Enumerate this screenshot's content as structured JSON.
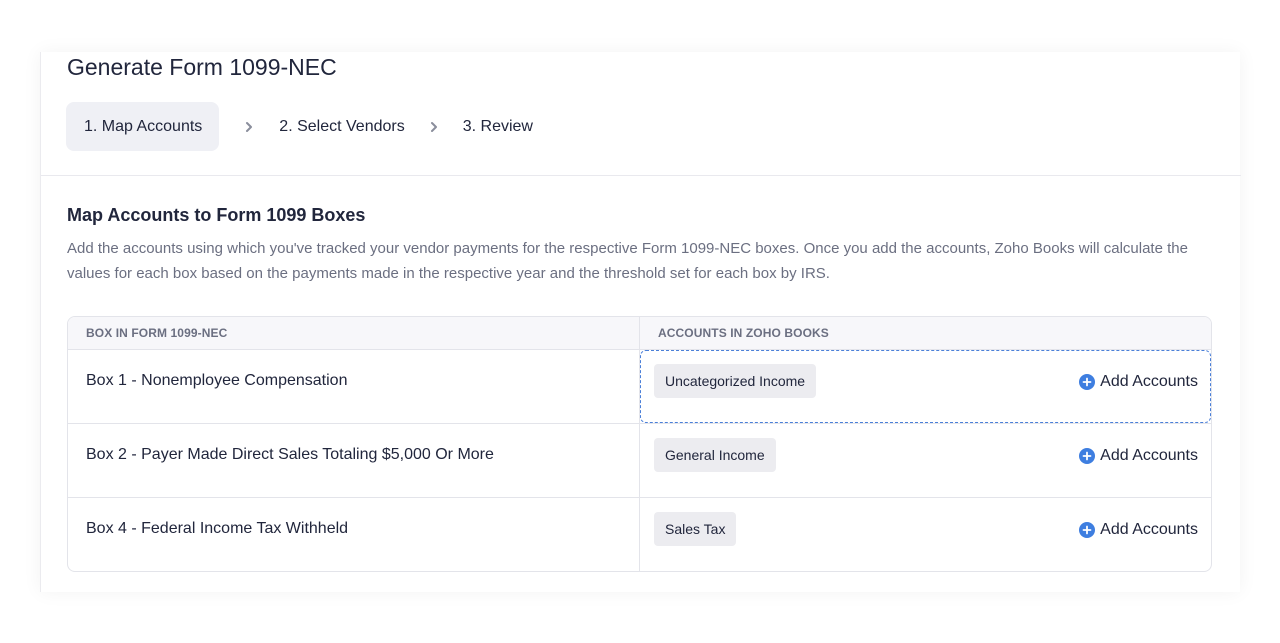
{
  "page": {
    "title": "Generate Form 1099-NEC"
  },
  "steps": [
    {
      "label": "1. Map Accounts",
      "active": true
    },
    {
      "label": "2. Select Vendors",
      "active": false
    },
    {
      "label": "3. Review",
      "active": false
    }
  ],
  "section": {
    "title": "Map Accounts to Form 1099 Boxes",
    "description": "Add the accounts using which you've tracked your vendor payments for the respective Form 1099-NEC boxes. Once you add the accounts, Zoho Books will calculate the values for each box based on the payments made in the respective year and the threshold set for each box by IRS."
  },
  "table": {
    "headers": {
      "box": "BOX IN FORM 1099-NEC",
      "accounts": "ACCOUNTS IN ZOHO BOOKS"
    },
    "rows": [
      {
        "box": "Box 1 - Nonemployee Compensation",
        "account": "Uncategorized Income",
        "add_label": "Add Accounts"
      },
      {
        "box": "Box 2 - Payer Made Direct Sales Totaling $5,000 Or More",
        "account": "General Income",
        "add_label": "Add Accounts"
      },
      {
        "box": "Box 4 - Federal Income Tax Withheld",
        "account": "Sales Tax",
        "add_label": "Add Accounts"
      }
    ]
  },
  "icons": {
    "step_separator": "chevron-right-icon",
    "add": "plus-circle-icon"
  },
  "colors": {
    "accent": "#3e7ee0",
    "active_step_bg": "#eff0f5",
    "chip_bg": "#ececf0"
  }
}
